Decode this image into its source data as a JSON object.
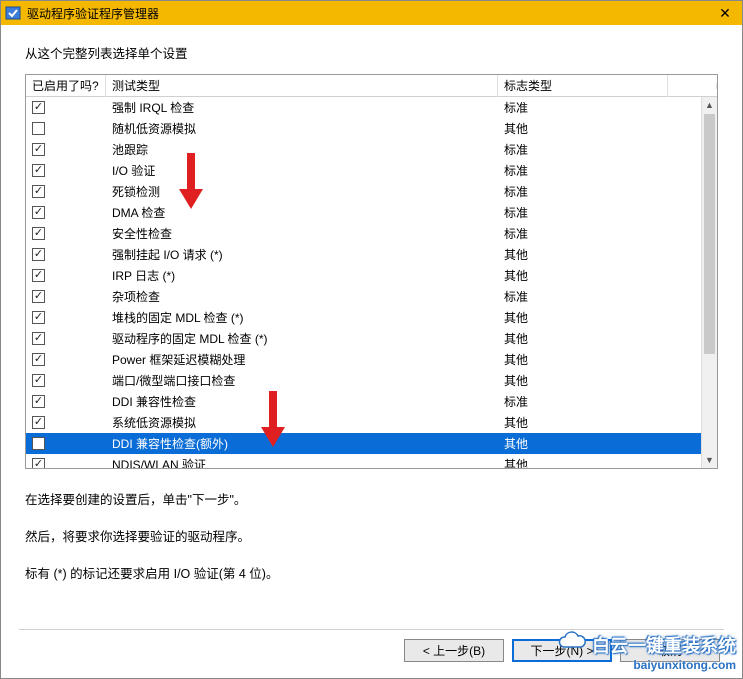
{
  "window": {
    "title": "驱动程序验证程序管理器"
  },
  "instruction": "从这个完整列表选择单个设置",
  "columns": {
    "enabled": "已启用了吗?",
    "test_type": "测试类型",
    "flag_type": "标志类型"
  },
  "rows": [
    {
      "checked": true,
      "selected": false,
      "test": "强制 IRQL 检查",
      "flag": "标准"
    },
    {
      "checked": false,
      "selected": false,
      "test": "随机低资源模拟",
      "flag": "其他"
    },
    {
      "checked": true,
      "selected": false,
      "test": "池跟踪",
      "flag": "标准"
    },
    {
      "checked": true,
      "selected": false,
      "test": "I/O 验证",
      "flag": "标准"
    },
    {
      "checked": true,
      "selected": false,
      "test": "死锁检测",
      "flag": "标准"
    },
    {
      "checked": true,
      "selected": false,
      "test": "DMA 检查",
      "flag": "标准"
    },
    {
      "checked": true,
      "selected": false,
      "test": "安全性检查",
      "flag": "标准"
    },
    {
      "checked": true,
      "selected": false,
      "test": "强制挂起 I/O 请求 (*)",
      "flag": "其他"
    },
    {
      "checked": true,
      "selected": false,
      "test": "IRP 日志 (*)",
      "flag": "其他"
    },
    {
      "checked": true,
      "selected": false,
      "test": "杂项检查",
      "flag": "标准"
    },
    {
      "checked": true,
      "selected": false,
      "test": "堆栈的固定 MDL 检查 (*)",
      "flag": "其他"
    },
    {
      "checked": true,
      "selected": false,
      "test": "驱动程序的固定 MDL 检查 (*)",
      "flag": "其他"
    },
    {
      "checked": true,
      "selected": false,
      "test": "Power 框架延迟模糊处理",
      "flag": "其他"
    },
    {
      "checked": true,
      "selected": false,
      "test": "端口/微型端口接口检查",
      "flag": "其他"
    },
    {
      "checked": true,
      "selected": false,
      "test": "DDI 兼容性检查",
      "flag": "标准"
    },
    {
      "checked": true,
      "selected": false,
      "test": "系统低资源模拟",
      "flag": "其他"
    },
    {
      "checked": false,
      "selected": true,
      "test": "DDI 兼容性检查(额外)",
      "flag": "其他"
    },
    {
      "checked": true,
      "selected": false,
      "test": "NDIS/WLAN 验证",
      "flag": "其他"
    }
  ],
  "help_texts": {
    "line1": "在选择要创建的设置后，单击\"下一步\"。",
    "line2": "然后，将要求你选择要验证的驱动程序。",
    "line3": "标有 (*) 的标记还要求启用 I/O 验证(第 4 位)。"
  },
  "buttons": {
    "back": "< 上一步(B)",
    "next": "下一步(N) >",
    "cancel": "取消"
  },
  "watermark": {
    "brand": "白云一键重装系统",
    "url": "baiyunxitong.com"
  }
}
